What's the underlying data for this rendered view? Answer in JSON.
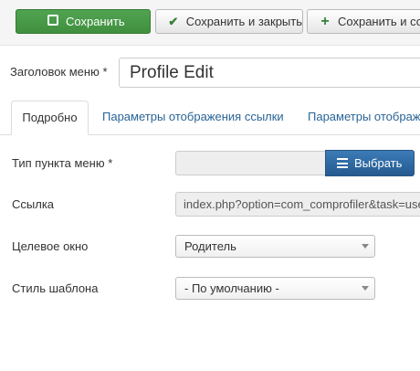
{
  "toolbar": {
    "save_label": "Сохранить",
    "save_close_label": "Сохранить и закрыть",
    "save_new_label": "Сохранить и соз"
  },
  "form": {
    "title_label": "Заголовок меню *",
    "title_value": "Profile Edit"
  },
  "tabs": [
    {
      "label": "Подробно",
      "active": true
    },
    {
      "label": "Параметры отображения ссылки",
      "active": false
    },
    {
      "label": "Параметры отображе",
      "active": false
    }
  ],
  "fields": {
    "menu_type_label": "Тип пункта меню *",
    "menu_type_value": "",
    "select_button_label": "Выбрать",
    "link_label": "Ссылка",
    "link_value": "index.php?option=com_comprofiler&task=userdetails",
    "target_window_label": "Целевое окно",
    "target_window_value": "Родитель",
    "template_style_label": "Стиль шаблона",
    "template_style_value": "- По умолчанию -"
  },
  "colors": {
    "save_button": "#469e46",
    "select_button": "#2f6ba4",
    "link_text": "#2a6496",
    "check_icon": "#378137"
  },
  "icons": [
    "edit-icon",
    "check-icon",
    "plus-icon",
    "list-icon",
    "caret-down-icon"
  ]
}
